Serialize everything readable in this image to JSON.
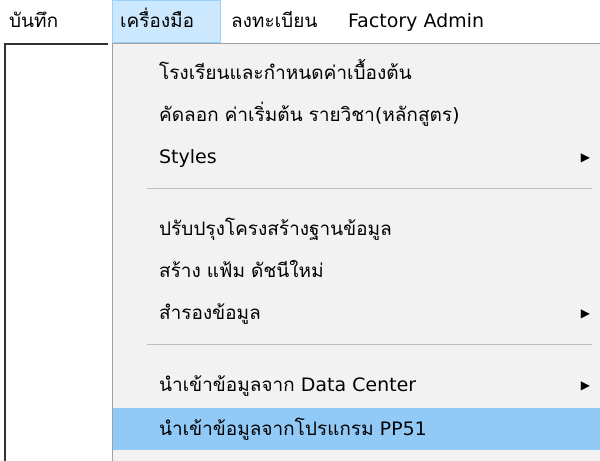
{
  "menubar": {
    "items": [
      {
        "label": "บันทึก"
      },
      {
        "label": "เครื่องมือ"
      },
      {
        "label": "ลงทะเบียน"
      },
      {
        "label": "Factory Admin"
      }
    ]
  },
  "dropdown": {
    "items": [
      {
        "label": "โรงเรียนและกำหนดค่าเบื้องต้น"
      },
      {
        "label": "คัดลอก ค่าเริ่มต้น รายวิชา(หลักสูตร)"
      },
      {
        "label": "Styles",
        "submenu_arrow": "▶"
      },
      {
        "label": "ปรับปรุงโครงสร้างฐานข้อมูล"
      },
      {
        "label": "สร้าง แฟ้ม ดัชนีใหม่"
      },
      {
        "label": "สำรองข้อมูล",
        "submenu_arrow": "▶"
      },
      {
        "label": "นำเข้าข้อมูลจาก Data Center",
        "submenu_arrow": "▶"
      },
      {
        "label": "นำเข้าข้อมูลจากโปรแกรม PP51"
      }
    ]
  },
  "colors": {
    "menu_open_bg": "#cce8ff",
    "menu_open_border": "#99d1ff",
    "dropdown_bg": "#f2f2f2",
    "highlight_bg": "#91c9f7"
  }
}
